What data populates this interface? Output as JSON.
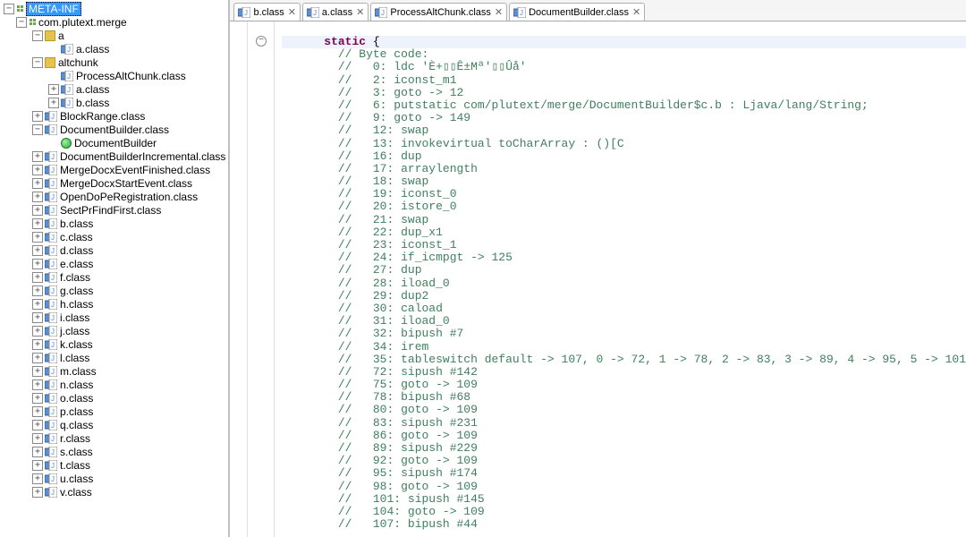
{
  "tabs": [
    {
      "label": "b.class"
    },
    {
      "label": "a.class"
    },
    {
      "label": "ProcessAltChunk.class"
    },
    {
      "label": "DocumentBuilder.class"
    }
  ],
  "tree": {
    "root": {
      "label": "META-INF"
    },
    "package": {
      "label": "com.plutext.merge"
    },
    "nodes": [
      {
        "depth": 2,
        "exp": "minus",
        "icon": "pkg",
        "label": "a"
      },
      {
        "depth": 3,
        "exp": "none",
        "icon": "j",
        "label": "a.class"
      },
      {
        "depth": 2,
        "exp": "minus",
        "icon": "pkg",
        "label": "altchunk"
      },
      {
        "depth": 3,
        "exp": "none",
        "icon": "j",
        "label": "ProcessAltChunk.class"
      },
      {
        "depth": 3,
        "exp": "plus",
        "icon": "j",
        "label": "a.class"
      },
      {
        "depth": 3,
        "exp": "plus",
        "icon": "j",
        "label": "b.class"
      },
      {
        "depth": 2,
        "exp": "plus",
        "icon": "j",
        "label": "BlockRange.class"
      },
      {
        "depth": 2,
        "exp": "minus",
        "icon": "j",
        "label": "DocumentBuilder.class"
      },
      {
        "depth": 3,
        "exp": "none",
        "icon": "grn",
        "label": "DocumentBuilder"
      },
      {
        "depth": 2,
        "exp": "plus",
        "icon": "j",
        "label": "DocumentBuilderIncremental.class"
      },
      {
        "depth": 2,
        "exp": "plus",
        "icon": "j",
        "label": "MergeDocxEventFinished.class"
      },
      {
        "depth": 2,
        "exp": "plus",
        "icon": "j",
        "label": "MergeDocxStartEvent.class"
      },
      {
        "depth": 2,
        "exp": "plus",
        "icon": "j",
        "label": "OpenDoPeRegistration.class"
      },
      {
        "depth": 2,
        "exp": "plus",
        "icon": "j",
        "label": "SectPrFindFirst.class"
      },
      {
        "depth": 2,
        "exp": "plus",
        "icon": "j",
        "label": "b.class"
      },
      {
        "depth": 2,
        "exp": "plus",
        "icon": "j",
        "label": "c.class"
      },
      {
        "depth": 2,
        "exp": "plus",
        "icon": "j",
        "label": "d.class"
      },
      {
        "depth": 2,
        "exp": "plus",
        "icon": "j",
        "label": "e.class"
      },
      {
        "depth": 2,
        "exp": "plus",
        "icon": "j",
        "label": "f.class"
      },
      {
        "depth": 2,
        "exp": "plus",
        "icon": "j",
        "label": "g.class"
      },
      {
        "depth": 2,
        "exp": "plus",
        "icon": "j",
        "label": "h.class"
      },
      {
        "depth": 2,
        "exp": "plus",
        "icon": "j",
        "label": "i.class"
      },
      {
        "depth": 2,
        "exp": "plus",
        "icon": "j",
        "label": "j.class"
      },
      {
        "depth": 2,
        "exp": "plus",
        "icon": "j",
        "label": "k.class"
      },
      {
        "depth": 2,
        "exp": "plus",
        "icon": "j",
        "label": "l.class"
      },
      {
        "depth": 2,
        "exp": "plus",
        "icon": "j",
        "label": "m.class"
      },
      {
        "depth": 2,
        "exp": "plus",
        "icon": "j",
        "label": "n.class"
      },
      {
        "depth": 2,
        "exp": "plus",
        "icon": "j",
        "label": "o.class"
      },
      {
        "depth": 2,
        "exp": "plus",
        "icon": "j",
        "label": "p.class"
      },
      {
        "depth": 2,
        "exp": "plus",
        "icon": "j",
        "label": "q.class"
      },
      {
        "depth": 2,
        "exp": "plus",
        "icon": "j",
        "label": "r.class"
      },
      {
        "depth": 2,
        "exp": "plus",
        "icon": "j",
        "label": "s.class"
      },
      {
        "depth": 2,
        "exp": "plus",
        "icon": "j",
        "label": "t.class"
      },
      {
        "depth": 2,
        "exp": "plus",
        "icon": "j",
        "label": "u.class"
      },
      {
        "depth": 2,
        "exp": "plus",
        "icon": "j",
        "label": "v.class"
      }
    ]
  },
  "code": {
    "indent": 6,
    "head": {
      "keyword": "static",
      "brace": " {"
    },
    "lines": [
      "// Byte code:",
      "//   0: ldc 'È+▯▯Ê±Mª'▯▯Ûå'",
      "//   2: iconst_m1",
      "//   3: goto -> 12",
      "//   6: putstatic com/plutext/merge/DocumentBuilder$c.b : Ljava/lang/String;",
      "//   9: goto -> 149",
      "//   12: swap",
      "//   13: invokevirtual toCharArray : ()[C",
      "//   16: dup",
      "//   17: arraylength",
      "//   18: swap",
      "//   19: iconst_0",
      "//   20: istore_0",
      "//   21: swap",
      "//   22: dup_x1",
      "//   23: iconst_1",
      "//   24: if_icmpgt -> 125",
      "//   27: dup",
      "//   28: iload_0",
      "//   29: dup2",
      "//   30: caload",
      "//   31: iload_0",
      "//   32: bipush #7",
      "//   34: irem",
      "//   35: tableswitch default -> 107, 0 -> 72, 1 -> 78, 2 -> 83, 3 -> 89, 4 -> 95, 5 -> 101",
      "//   72: sipush #142",
      "//   75: goto -> 109",
      "//   78: bipush #68",
      "//   80: goto -> 109",
      "//   83: sipush #231",
      "//   86: goto -> 109",
      "//   89: sipush #229",
      "//   92: goto -> 109",
      "//   95: sipush #174",
      "//   98: goto -> 109",
      "//   101: sipush #145",
      "//   104: goto -> 109",
      "//   107: bipush #44"
    ]
  }
}
